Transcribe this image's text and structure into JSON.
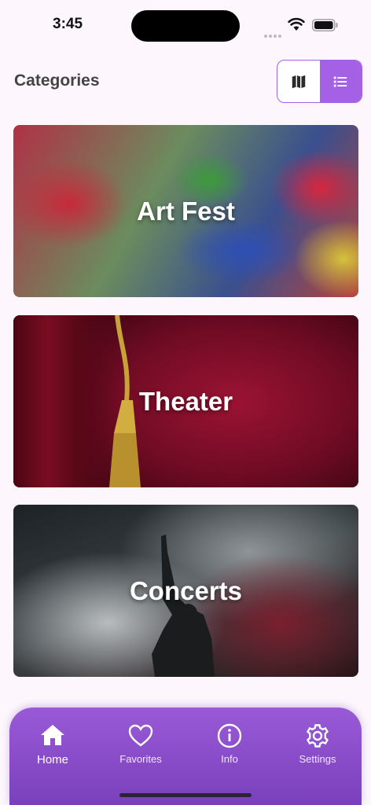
{
  "status_bar": {
    "time": "3:45"
  },
  "header": {
    "title": "Categories"
  },
  "view_toggle": {
    "options": [
      "map-view",
      "list-view"
    ],
    "selected": "list-view"
  },
  "categories": [
    {
      "title": "Art Fest"
    },
    {
      "title": "Theater"
    },
    {
      "title": "Concerts"
    }
  ],
  "bottom_nav": {
    "items": [
      {
        "label": "Home",
        "icon": "home-icon",
        "active": true
      },
      {
        "label": "Favorites",
        "icon": "heart-icon",
        "active": false
      },
      {
        "label": "Info",
        "icon": "info-icon",
        "active": false
      },
      {
        "label": "Settings",
        "icon": "gear-icon",
        "active": false
      }
    ]
  },
  "colors": {
    "accent": "#a461e6",
    "nav_bg": "#8a4dcb",
    "background": "#fdf7fd"
  }
}
